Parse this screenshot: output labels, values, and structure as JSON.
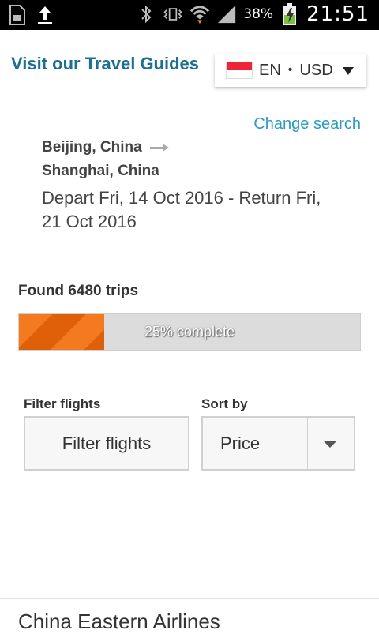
{
  "status_bar": {
    "battery_percent": "38%",
    "time": "21:51",
    "icons": [
      "sd-card-icon",
      "upload-icon",
      "bluetooth-icon",
      "vibrate-icon",
      "wifi-icon",
      "signal-icon",
      "battery-charging-icon"
    ]
  },
  "header": {
    "travel_guides": "Visit our Travel Guides",
    "locale": {
      "language": "EN",
      "separator": "•",
      "currency": "USD"
    }
  },
  "search": {
    "change_search": "Change search",
    "origin": "Beijing, China",
    "destination": "Shanghai, China",
    "dates": "Depart Fri, 14 Oct 2016 - Return Fri, 21 Oct 2016"
  },
  "progress": {
    "found_text": "Found 6480 trips",
    "percent": 25,
    "label": "25% complete"
  },
  "filters": {
    "filter_label": "Filter flights",
    "filter_button": "Filter flights",
    "sort_label": "Sort by",
    "sort_value": "Price"
  },
  "results": {
    "first_airline": "China Eastern Airlines"
  },
  "colors": {
    "accent_link": "#1b6f95",
    "change_search": "#2a9bc4",
    "progress_orange": "#f47a1f"
  }
}
